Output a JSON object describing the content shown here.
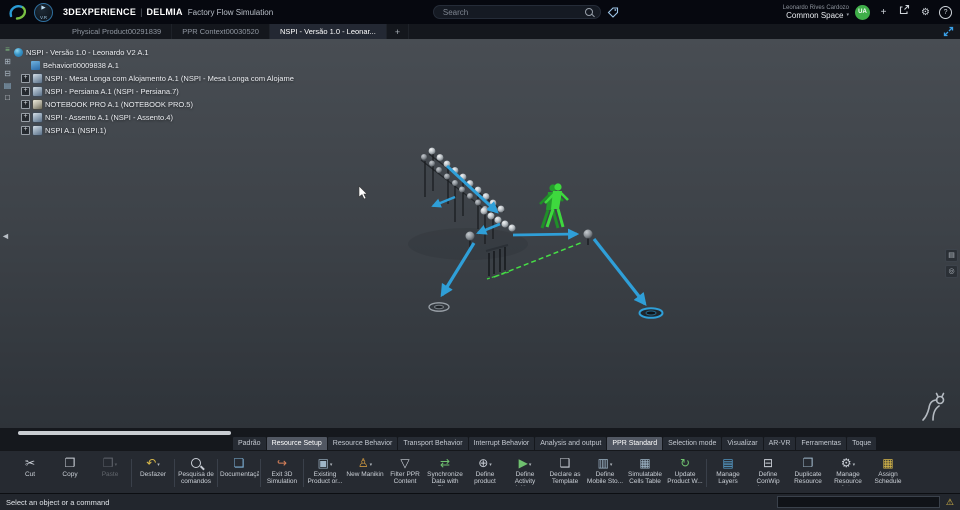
{
  "topbar": {
    "brand": "3DEXPERIENCE",
    "divider": "|",
    "app": "DELMIA",
    "app_suffix": "Factory Flow Simulation",
    "compass_label": "V.R",
    "search_placeholder": "Search",
    "user_name": "Leonardo Rives Cardozo",
    "space_label": "Common Space",
    "avatar_initials": "UA"
  },
  "doc_tabs": {
    "items": [
      {
        "label": "Physical Product00291839",
        "active": false
      },
      {
        "label": "PPR Context00030520",
        "active": false
      },
      {
        "label": "NSPI - Versão 1.0 - Leonar...",
        "active": true
      }
    ],
    "add_label": "+"
  },
  "tree": {
    "toolbar": [
      {
        "name": "explore-tree-icon",
        "glyph": "≡",
        "color": "#7fc07f"
      },
      {
        "name": "expand-node-icon",
        "glyph": "⊞",
        "color": "#a8b4c0"
      },
      {
        "name": "collapse-node-icon",
        "glyph": "⊟",
        "color": "#a8b4c0"
      },
      {
        "name": "filter-tree-icon",
        "glyph": "▤",
        "color": "#8fb2cc"
      },
      {
        "name": "select-mode-icon",
        "glyph": "□",
        "color": "#d8dce2"
      }
    ],
    "items": [
      {
        "label": "NSPI - Versão 1.0 - Leonardo V2 A.1",
        "icon": "world-icon",
        "expander": "",
        "indent": 0
      },
      {
        "label": "Behavior00009838 A.1",
        "icon": "behavior-icon",
        "expander": "",
        "indent": 1
      },
      {
        "label": "NSPI - Mesa Longa com Alojamento A.1 (NSPI - Mesa Longa com Alojame",
        "icon": "product-icon",
        "expander": "+",
        "indent": 1
      },
      {
        "label": "NSPI - Persiana A.1 (NSPI - Persiana.7)",
        "icon": "product-icon",
        "expander": "+",
        "indent": 1
      },
      {
        "label": "NOTEBOOK PRO A.1 (NOTEBOOK PRO.5)",
        "icon": "notebook-icon",
        "expander": "+",
        "indent": 1
      },
      {
        "label": "NSPI - Assento A.1 (NSPI - Assento.4)",
        "icon": "product-icon",
        "expander": "+",
        "indent": 1
      },
      {
        "label": "NSPI A.1 (NSPI.1)",
        "icon": "product-icon",
        "expander": "+",
        "indent": 1
      }
    ]
  },
  "ribbon_tabs": [
    {
      "label": "Padrão",
      "state": "normal"
    },
    {
      "label": "Resource Setup",
      "state": "active"
    },
    {
      "label": "Resource Behavior",
      "state": "normal"
    },
    {
      "label": "Transport Behavior",
      "state": "normal"
    },
    {
      "label": "Interrupt Behavior",
      "state": "normal"
    },
    {
      "label": "Analysis and output",
      "state": "normal"
    },
    {
      "label": "PPR Standard",
      "state": "active"
    },
    {
      "label": "Selection mode",
      "state": "normal"
    },
    {
      "label": "Visualizar",
      "state": "normal"
    },
    {
      "label": "AR-VR",
      "state": "normal"
    },
    {
      "label": "Ferramentas",
      "state": "normal"
    },
    {
      "label": "Toque",
      "state": "normal"
    }
  ],
  "toolbar": {
    "buttons": [
      {
        "label": "Cut",
        "icon": "cut-icon",
        "enabled": true
      },
      {
        "label": "Copy",
        "icon": "copy-icon",
        "enabled": true
      },
      {
        "label": "Paste",
        "icon": "paste-icon",
        "enabled": false,
        "caret": true,
        "sep_after": true
      },
      {
        "label": "Desfazer",
        "icon": "undo-icon",
        "enabled": true,
        "caret": true,
        "sep_after": true
      },
      {
        "label": "Pesquisa de comandos",
        "icon": "command-search-icon",
        "enabled": true,
        "sep_after": true
      },
      {
        "label": "Documentação",
        "icon": "documentation-icon",
        "enabled": true,
        "sep_after": true
      },
      {
        "label": "Exit 3D Simulation",
        "icon": "exit-simulation-icon",
        "enabled": true,
        "sep_after": true
      },
      {
        "label": "Existing Product or...",
        "icon": "existing-product-icon",
        "enabled": true,
        "caret": true
      },
      {
        "label": "New Manikin",
        "icon": "manikin-icon",
        "enabled": true,
        "caret": true
      },
      {
        "label": "Filter PPR Content",
        "icon": "filter-icon",
        "enabled": true
      },
      {
        "label": "Synchronize Data with Pla...",
        "icon": "synchronize-icon",
        "enabled": true
      },
      {
        "label": "Define product pos...",
        "icon": "define-position-icon",
        "enabled": true,
        "caret": true
      },
      {
        "label": "Define Activity Initia...",
        "icon": "activity-icon",
        "enabled": true,
        "caret": true
      },
      {
        "label": "Declare as Template",
        "icon": "template-icon",
        "enabled": true
      },
      {
        "label": "Define Mobile Sto...",
        "icon": "mobile-storage-icon",
        "enabled": true,
        "caret": true
      },
      {
        "label": "Simulatable Cells Table",
        "icon": "cells-table-icon",
        "enabled": true
      },
      {
        "label": "Update Product W...",
        "icon": "update-icon",
        "enabled": true,
        "sep_after": true
      },
      {
        "label": "Manage Layers",
        "icon": "layers-icon",
        "enabled": true
      },
      {
        "label": "Define ConWip boun...",
        "icon": "conwip-icon",
        "enabled": true
      },
      {
        "label": "Duplicate Resource",
        "icon": "duplicate-icon",
        "enabled": true
      },
      {
        "label": "Manage Resource Act...",
        "icon": "resource-activity-icon",
        "enabled": true,
        "caret": true
      },
      {
        "label": "Assign Schedule",
        "icon": "schedule-icon",
        "enabled": true
      }
    ]
  },
  "statusbar": {
    "message": "Select an object or a command"
  },
  "icons": {
    "play-icon": {
      "glyph": "▶",
      "color": "#bfe0f5"
    },
    "chevron-down-icon": {
      "glyph": "▾",
      "color": "#9aa0a8"
    },
    "add-icon": {
      "glyph": "+",
      "color": "#cfd4da"
    },
    "tools-icon": {
      "glyph": "⚙",
      "color": "#cfd4da"
    },
    "help-icon": {
      "glyph": "?",
      "color": "#cfd4da"
    },
    "collapse-panel-arrow": {
      "glyph": "◄",
      "color": "#b8bec5"
    },
    "panel-layers-icon": {
      "glyph": "▤",
      "color": "#b6bcc3"
    },
    "panel-target-icon": {
      "glyph": "◎",
      "color": "#b6bcc3"
    },
    "warning-icon": {
      "glyph": "⚠",
      "color": "#e6c34a"
    },
    "cut-icon": {
      "glyph": "✂",
      "color": "#c9ced6"
    },
    "copy-icon": {
      "glyph": "❐",
      "color": "#c9ced6"
    },
    "paste-icon": {
      "glyph": "❒",
      "color": "#c9ced6"
    },
    "undo-icon": {
      "glyph": "↶",
      "color": "#d8b84a"
    },
    "command-search-icon": {
      "glyph": "",
      "color": "#c9ced6"
    },
    "documentation-icon": {
      "glyph": "❏",
      "color": "#7fb2d8"
    },
    "exit-simulation-icon": {
      "glyph": "↪",
      "color": "#d8815a"
    },
    "existing-product-icon": {
      "glyph": "▣",
      "color": "#9fb6c8"
    },
    "manikin-icon": {
      "glyph": "♙",
      "color": "#e0a340"
    },
    "filter-icon": {
      "glyph": "▽",
      "color": "#c9ced6"
    },
    "synchronize-icon": {
      "glyph": "⇄",
      "color": "#6fc06f"
    },
    "define-position-icon": {
      "glyph": "⊕",
      "color": "#c9ced6"
    },
    "activity-icon": {
      "glyph": "▶",
      "color": "#6fc06f"
    },
    "template-icon": {
      "glyph": "❑",
      "color": "#c9ced6"
    },
    "mobile-storage-icon": {
      "glyph": "▥",
      "color": "#9fb6c8"
    },
    "cells-table-icon": {
      "glyph": "▦",
      "color": "#9fb6c8"
    },
    "update-icon": {
      "glyph": "↻",
      "color": "#6fc06f"
    },
    "layers-icon": {
      "glyph": "▤",
      "color": "#5aa8d8"
    },
    "conwip-icon": {
      "glyph": "⊟",
      "color": "#c9ced6"
    },
    "duplicate-icon": {
      "glyph": "❐",
      "color": "#9fb6c8"
    },
    "resource-activity-icon": {
      "glyph": "⚙",
      "color": "#c9ced6"
    },
    "schedule-icon": {
      "glyph": "▦",
      "color": "#d8b84a"
    }
  }
}
